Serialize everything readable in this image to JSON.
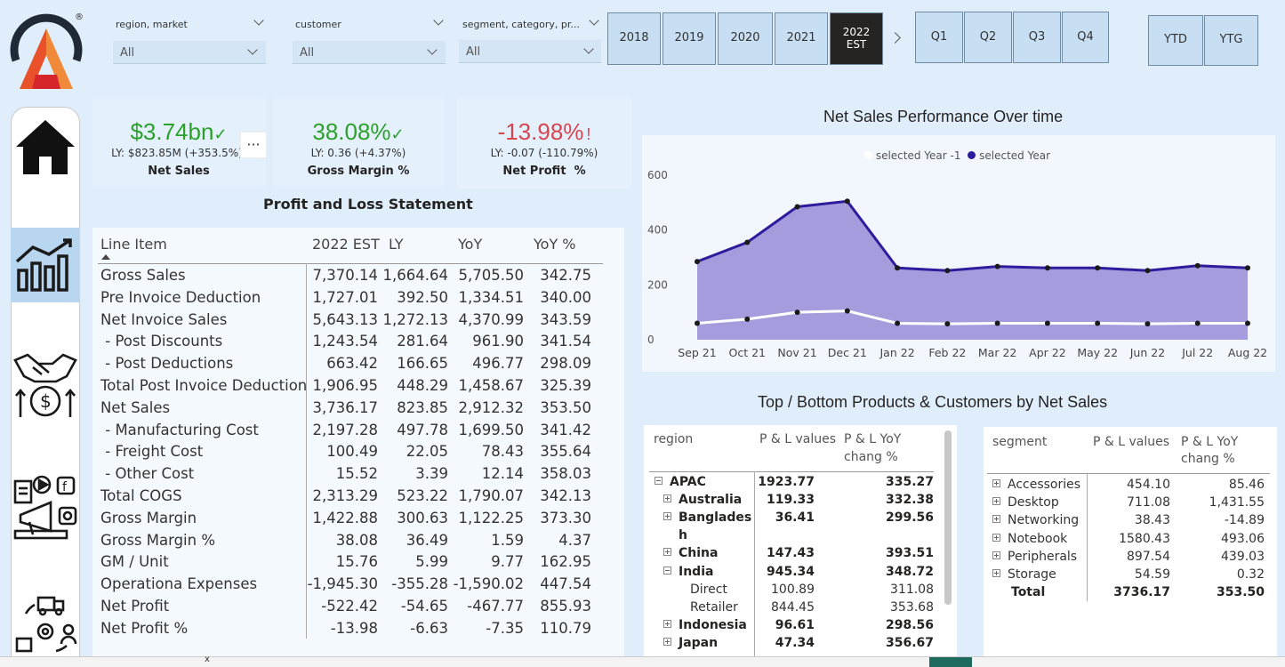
{
  "logo": {
    "registered": "®"
  },
  "slicers": [
    {
      "title": "region, market",
      "value": "All"
    },
    {
      "title": "customer",
      "value": "All"
    },
    {
      "title": "segment, category, pr...",
      "value": "All"
    }
  ],
  "years": [
    "2018",
    "2019",
    "2020",
    "2021"
  ],
  "active_year": {
    "line1": "2022",
    "line2": "EST"
  },
  "quarters": [
    "Q1",
    "Q2",
    "Q3",
    "Q4"
  ],
  "ytd": [
    "YTD",
    "YTG"
  ],
  "kpis": [
    {
      "value": "$3.74bn",
      "mark": "✓",
      "ly": "LY: $823.85M (+353.5%)",
      "label": "Net Sales",
      "color": "#2ca02c"
    },
    {
      "value": "38.08%",
      "mark": "✓",
      "ly": "LY: 0.36 (+4.37%)",
      "label": "Gross Margin %",
      "color": "#2ca02c"
    },
    {
      "value": "-13.98%",
      "mark": "!",
      "ly": "LY: -0.07 (-110.79%)",
      "label": "Net Profit  %",
      "color": "#d64550"
    }
  ],
  "more_options": "···",
  "pl": {
    "title": "Profit and Loss Statement",
    "headers": [
      "Line Item",
      "2022 EST",
      "LY",
      "YoY",
      "YoY %"
    ],
    "rows": [
      [
        "Gross Sales",
        "7,370.14",
        "1,664.64",
        "5,705.50",
        "342.75"
      ],
      [
        "Pre Invoice Deduction",
        "1,727.01",
        "392.50",
        "1,334.51",
        "340.00"
      ],
      [
        "Net Invoice Sales",
        "5,643.13",
        "1,272.13",
        "4,370.99",
        "343.59"
      ],
      [
        " - Post Discounts",
        "1,243.54",
        "281.64",
        "961.90",
        "341.54"
      ],
      [
        " - Post Deductions",
        "663.42",
        "166.65",
        "496.77",
        "298.09"
      ],
      [
        "Total Post Invoice Deduction",
        "1,906.95",
        "448.29",
        "1,458.67",
        "325.39"
      ],
      [
        "Net Sales",
        "3,736.17",
        "823.85",
        "2,912.32",
        "353.50"
      ],
      [
        " - Manufacturing Cost",
        "2,197.28",
        "497.78",
        "1,699.50",
        "341.42"
      ],
      [
        " - Freight Cost",
        "100.49",
        "22.05",
        "78.43",
        "355.64"
      ],
      [
        " - Other Cost",
        "15.52",
        "3.39",
        "12.14",
        "358.03"
      ],
      [
        "Total COGS",
        "2,313.29",
        "523.22",
        "1,790.07",
        "342.13"
      ],
      [
        "Gross Margin",
        "1,422.88",
        "300.63",
        "1,122.25",
        "373.30"
      ],
      [
        "Gross Margin %",
        "38.08",
        "36.49",
        "1.59",
        "4.37"
      ],
      [
        "GM / Unit",
        "15.76",
        "5.99",
        "9.77",
        "162.95"
      ],
      [
        "Operationa Expenses",
        "-1,945.30",
        "-355.28",
        "-1,590.02",
        "447.54"
      ],
      [
        "Net Profit",
        "-522.42",
        "-54.65",
        "-467.77",
        "855.93"
      ],
      [
        "Net Profit %",
        "-13.98",
        "-6.63",
        "-7.35",
        "110.79"
      ]
    ]
  },
  "chart_title": "Net Sales Performance Over time",
  "chart_data": {
    "type": "area",
    "categories": [
      "Sep 21",
      "Oct 21",
      "Nov 21",
      "Dec 21",
      "Jan 22",
      "Feb 22",
      "Mar 22",
      "Apr 22",
      "May 22",
      "Jun 22",
      "Jul 22",
      "Aug 22"
    ],
    "series": [
      {
        "name": "selected Year",
        "values": [
          285,
          355,
          485,
          505,
          262,
          252,
          267,
          262,
          262,
          252,
          270,
          262
        ],
        "color": "#2e1c9c"
      },
      {
        "name": "selected Year -1",
        "values": [
          60,
          75,
          100,
          105,
          60,
          58,
          60,
          60,
          60,
          58,
          60,
          60
        ],
        "color": "#ffffff"
      }
    ],
    "yticks": [
      0,
      200,
      400,
      600
    ],
    "ylim": [
      0,
      600
    ],
    "area_fill": "#a49cdc"
  },
  "top_bottom_title": "Top / Bottom Products & Customers by Net Sales",
  "region_table": {
    "headers": [
      "region",
      "P & L values",
      "P & L YoY",
      "chang %"
    ],
    "rows": [
      {
        "label": "APAC",
        "v": "1923.77",
        "y": "335.27",
        "level": 0,
        "bold": true,
        "sign": "minus"
      },
      {
        "label": "Australia",
        "v": "119.33",
        "y": "332.38",
        "level": 1,
        "bold": true,
        "sign": "plus"
      },
      {
        "label": "Banglades",
        "v": "36.41",
        "y": "299.56",
        "level": 1,
        "bold": true,
        "sign": "plus"
      },
      {
        "label": "h",
        "v": "",
        "y": "",
        "level": 1,
        "bold": true,
        "sign": ""
      },
      {
        "label": "China",
        "v": "147.43",
        "y": "393.51",
        "level": 1,
        "bold": true,
        "sign": "plus"
      },
      {
        "label": "India",
        "v": "945.34",
        "y": "348.72",
        "level": 1,
        "bold": true,
        "sign": "minus"
      },
      {
        "label": "Direct",
        "v": "100.89",
        "y": "311.08",
        "level": 2,
        "bold": false,
        "sign": ""
      },
      {
        "label": "Retailer",
        "v": "844.45",
        "y": "353.68",
        "level": 2,
        "bold": false,
        "sign": ""
      },
      {
        "label": "Indonesia",
        "v": "96.61",
        "y": "298.56",
        "level": 1,
        "bold": true,
        "sign": "plus"
      },
      {
        "label": "Japan",
        "v": "47.34",
        "y": "356.67",
        "level": 1,
        "bold": true,
        "sign": "plus"
      }
    ]
  },
  "segment_table": {
    "headers": [
      "segment",
      "P & L values",
      "P & L YoY",
      "chang %"
    ],
    "rows": [
      {
        "label": "Accessories",
        "v": "454.10",
        "y": "85.46"
      },
      {
        "label": "Desktop",
        "v": "711.08",
        "y": "1,431.55"
      },
      {
        "label": "Networking",
        "v": "38.43",
        "y": "-14.89"
      },
      {
        "label": "Notebook",
        "v": "1580.43",
        "y": "493.06"
      },
      {
        "label": "Peripherals",
        "v": "897.54",
        "y": "439.03"
      },
      {
        "label": "Storage",
        "v": "54.59",
        "y": "0.32"
      }
    ],
    "total": {
      "label": "Total",
      "v": "3736.17",
      "y": "353.50"
    }
  },
  "tab_close": "x"
}
